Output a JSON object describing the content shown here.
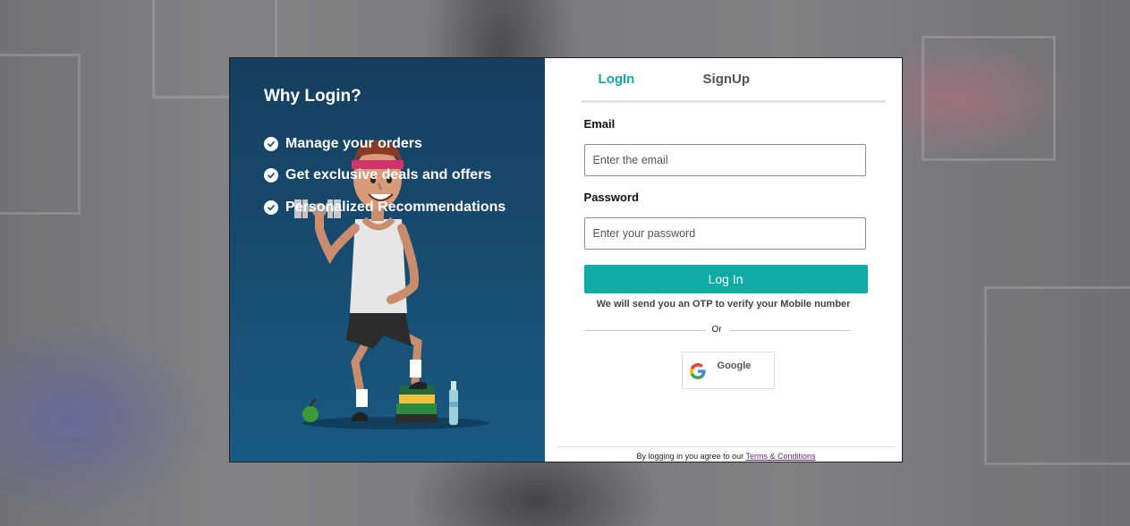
{
  "left_panel": {
    "title": "Why Login?",
    "benefits": [
      "Manage your orders",
      "Get exclusive deals and offers",
      "Personalized Recommendations"
    ]
  },
  "tabs": {
    "login": "LogIn",
    "signup": "SignUp",
    "active": "LogIn"
  },
  "form": {
    "email_label": "Email",
    "email_placeholder": "Enter the email",
    "password_label": "Password",
    "password_placeholder": "Enter your password",
    "submit_label": "Log In",
    "otp_note": "We will send you an OTP to verify your Mobile number",
    "divider_text": "Or",
    "google_label": "Google"
  },
  "footer": {
    "prefix": "By logging in you agree to our",
    "link": "Terms & Conditions"
  },
  "colors": {
    "accent": "#11aba6",
    "panel_top": "#163e5e",
    "panel_bottom": "#185a82"
  }
}
